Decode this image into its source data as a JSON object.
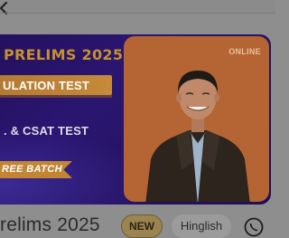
{
  "banner": {
    "heading": "PRELIMS 2025",
    "strip_label": "ULATION TEST",
    "subheading": ". & CSAT TEST",
    "tag_label": "REE BATCH",
    "mode_label": "ONLINE"
  },
  "course": {
    "title": "relims 2025",
    "new_badge": "NEW",
    "language_badge": "Hinglish"
  },
  "icons": {
    "back": "chevron-left-icon",
    "contact": "phone-icon"
  },
  "colors": {
    "banner_bg": "#24115e",
    "accent_orange": "#c18634",
    "photo_bg": "#b56434"
  }
}
